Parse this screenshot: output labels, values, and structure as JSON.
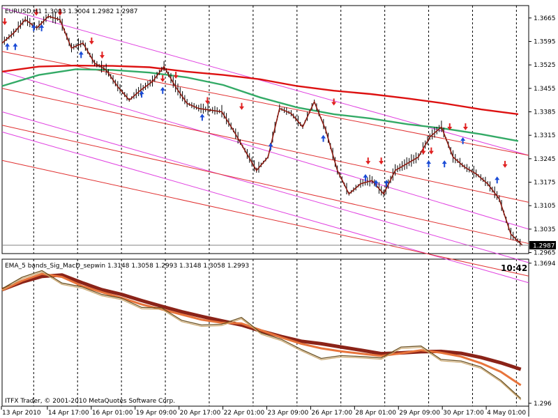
{
  "chart_data": [
    {
      "type": "line",
      "chart_title": "EURUSD,H1  1.3003 1.3004 1.2982 1.2987",
      "ylim": [
        1.2962,
        1.3702
      ],
      "y_ticks": [
        "1.3665",
        "1.3595",
        "1.3525",
        "1.3455",
        "1.3385",
        "1.3315",
        "1.3245",
        "1.3175",
        "1.3105",
        "1.3035",
        "1.2965"
      ],
      "y_tick_values": [
        1.3665,
        1.3595,
        1.3525,
        1.3455,
        1.3385,
        1.3315,
        1.3245,
        1.3175,
        1.3105,
        1.3035,
        1.2965
      ],
      "current_price": "1.2987",
      "x_labels": [
        "13 Apr 2010",
        "14 Apr 17:00",
        "16 Apr 01:00",
        "19 Apr 09:00",
        "20 Apr 17:00",
        "22 Apr 01:00",
        "23 Apr 09:00",
        "26 Apr 17:00",
        "28 Apr 01:00",
        "29 Apr 09:00",
        "30 Apr 17:00",
        "4 May 01:00"
      ],
      "price": [
        1.359,
        1.362,
        1.366,
        1.3635,
        1.367,
        1.366,
        1.3575,
        1.359,
        1.353,
        1.351,
        1.346,
        1.342,
        1.345,
        1.3475,
        1.352,
        1.346,
        1.341,
        1.3395,
        1.339,
        1.3385,
        1.333,
        1.327,
        1.321,
        1.325,
        1.3395,
        1.338,
        1.334,
        1.3415,
        1.333,
        1.321,
        1.314,
        1.317,
        1.318,
        1.314,
        1.321,
        1.323,
        1.325,
        1.331,
        1.334,
        1.325,
        1.322,
        1.32,
        1.317,
        1.3125,
        1.302,
        1.2987
      ],
      "series": [
        {
          "name": "",
          "color": "#dd1111",
          "values": [
            1.3505,
            1.352,
            1.3523,
            1.3522,
            1.3518,
            1.3505,
            1.3495,
            1.3482,
            1.3462,
            1.3448,
            1.3438,
            1.3425,
            1.341,
            1.3392,
            1.3378
          ]
        },
        {
          "name": "",
          "color": "#33aa66",
          "values": [
            1.3462,
            1.3495,
            1.3512,
            1.351,
            1.3502,
            1.3488,
            1.3465,
            1.3428,
            1.3398,
            1.3378,
            1.3365,
            1.3348,
            1.3335,
            1.3318,
            1.3298
          ]
        }
      ],
      "up_arrows": [
        [
          0.01,
          1.3586
        ],
        [
          0.025,
          1.3586
        ],
        [
          0.06,
          1.3642
        ],
        [
          0.075,
          1.3642
        ],
        [
          0.15,
          1.3562
        ],
        [
          0.265,
          1.3444
        ],
        [
          0.305,
          1.3455
        ],
        [
          0.38,
          1.3375
        ],
        [
          0.51,
          1.3288
        ],
        [
          0.61,
          1.3312
        ],
        [
          0.69,
          1.3195
        ],
        [
          0.71,
          1.3178
        ],
        [
          0.73,
          1.3178
        ],
        [
          0.81,
          1.3236
        ],
        [
          0.84,
          1.3236
        ],
        [
          0.875,
          1.3305
        ],
        [
          0.94,
          1.3188
        ]
      ],
      "down_arrows": [
        [
          0.005,
          1.3648
        ],
        [
          0.065,
          1.3676
        ],
        [
          0.11,
          1.3676
        ],
        [
          0.17,
          1.359
        ],
        [
          0.19,
          1.3548
        ],
        [
          0.305,
          1.3478
        ],
        [
          0.33,
          1.3488
        ],
        [
          0.39,
          1.3412
        ],
        [
          0.455,
          1.3395
        ],
        [
          0.63,
          1.3408
        ],
        [
          0.695,
          1.3232
        ],
        [
          0.72,
          1.3232
        ],
        [
          0.8,
          1.3262
        ],
        [
          0.815,
          1.3262
        ],
        [
          0.85,
          1.3334
        ],
        [
          0.88,
          1.3334
        ],
        [
          0.955,
          1.3222
        ]
      ],
      "overlay_lines": {
        "magenta": [
          [
            1.3695,
            1.3255
          ],
          [
            1.3505,
            1.3035
          ],
          [
            1.3385,
            1.2935
          ],
          [
            1.3325,
            1.2875
          ]
        ],
        "red": [
          [
            1.3565,
            1.3255
          ],
          [
            1.3455,
            1.3115
          ],
          [
            1.3345,
            1.2992
          ],
          [
            1.324,
            1.2895
          ]
        ]
      }
    },
    {
      "type": "line",
      "chart_title": "EMA_5 bands_Sig_MacD_sepwin 1.3148 1.3058 1.2993 1.3148 1.3058 1.2993",
      "clock": "10:42",
      "ylim": [
        1.2945,
        1.3715
      ],
      "y_ticks": [
        "1.3694",
        "1.296"
      ],
      "y_tick_values": [
        1.3694,
        1.296
      ],
      "footer": "ITFX Trader, © 2001-2010 MetaQuotes Software Corp.",
      "series": [
        {
          "name": "",
          "color": "#8b2318",
          "values": [
            1.3555,
            1.3595,
            1.3625,
            1.3632,
            1.3592,
            1.3555,
            1.353,
            1.3498,
            1.3468,
            1.344,
            1.3415,
            1.3392,
            1.337,
            1.3338,
            1.331,
            1.3285,
            1.3272,
            1.3255,
            1.3238,
            1.322,
            1.3224,
            1.323,
            1.3232,
            1.3222,
            1.32,
            1.3172,
            1.3138
          ]
        },
        {
          "name": "",
          "color": "#e8743b",
          "values": [
            1.3552,
            1.3602,
            1.3638,
            1.3622,
            1.3575,
            1.3542,
            1.3512,
            1.3478,
            1.3452,
            1.3425,
            1.3398,
            1.3382,
            1.3378,
            1.3342,
            1.3305,
            1.3272,
            1.3248,
            1.3232,
            1.322,
            1.3208,
            1.3222,
            1.3238,
            1.3225,
            1.3205,
            1.317,
            1.3125,
            1.3055
          ]
        },
        {
          "name": "",
          "color": "#6b5020",
          "values": [
            1.356,
            1.362,
            1.3655,
            1.359,
            1.357,
            1.353,
            1.351,
            1.3462,
            1.346,
            1.3395,
            1.337,
            1.3374,
            1.341,
            1.3328,
            1.3295,
            1.3242,
            1.3195,
            1.321,
            1.3205,
            1.3198,
            1.3255,
            1.326,
            1.319,
            1.3182,
            1.315,
            1.308,
            1.2985
          ]
        }
      ]
    }
  ]
}
